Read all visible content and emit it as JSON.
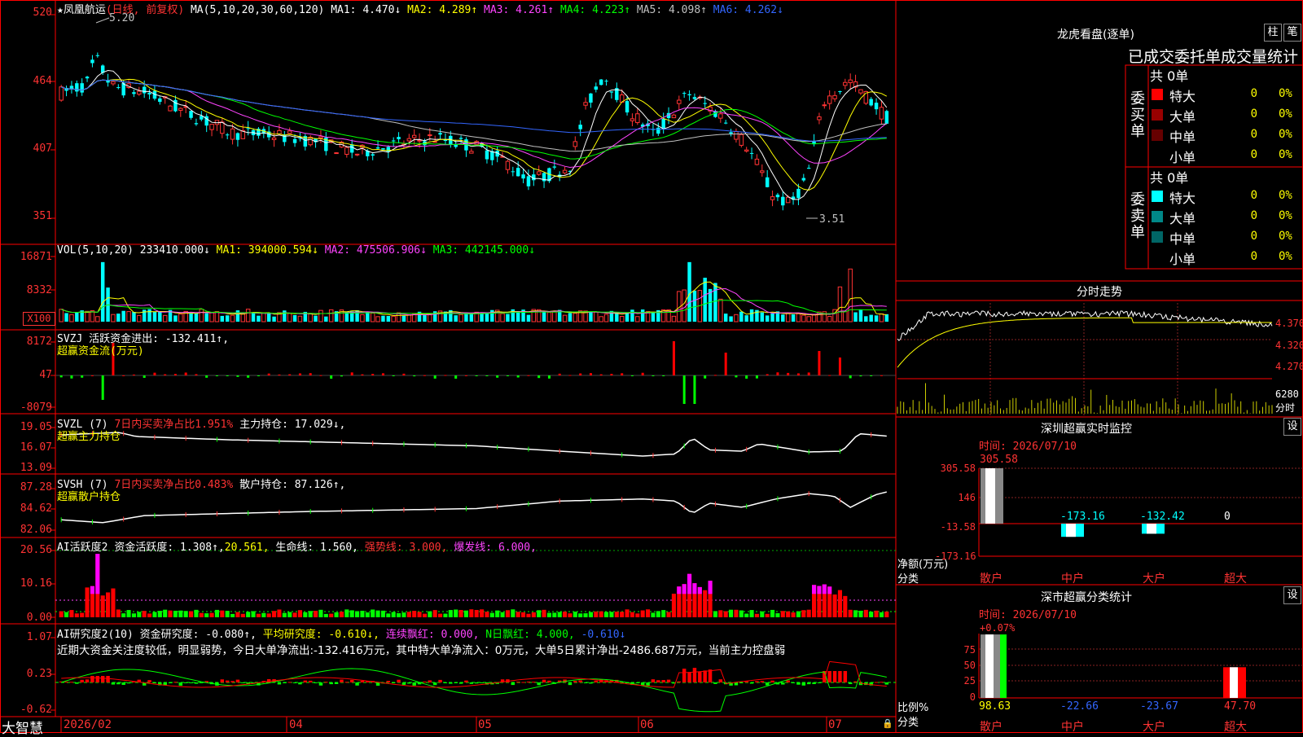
{
  "main_header": {
    "star": "★",
    "name": "凤凰航运",
    "period": "(日线, 前复权)",
    "ma_params": "MA(5,10,20,30,60,120)",
    "ma": [
      {
        "label": "MA1: 4.470↓",
        "color": "#ffffff"
      },
      {
        "label": "MA2: 4.289↑",
        "color": "#ffff00"
      },
      {
        "label": "MA3: 4.261↑",
        "color": "#ff44ff"
      },
      {
        "label": "MA4: 4.223↑",
        "color": "#00ff00"
      },
      {
        "label": "MA5: 4.098↑",
        "color": "#c0c0c0"
      },
      {
        "label": "MA6: 4.262↓",
        "color": "#3366ff"
      }
    ]
  },
  "main_axis": [
    "520",
    "464",
    "407",
    "351"
  ],
  "high_label": "5.20",
  "low_label": "3.51",
  "vol_header": {
    "name": "VOL(5,10,20)",
    "val": "233410.000↓",
    "ma1": "MA1: 394000.594↓",
    "ma2": "MA2: 475506.906↓",
    "ma3": "MA3: 442145.000↓"
  },
  "vol_axis": [
    "16871",
    "8332",
    "X100"
  ],
  "svzj_header": {
    "name": "SVZJ",
    "desc": "活跃资金进出: -132.411↑,",
    "sub": "超赢资金流(万元)"
  },
  "svzj_axis": [
    "8172",
    "47",
    "-8079"
  ],
  "svzl_header": {
    "name": "SVZL (7)",
    "desc": "7日内买卖净占比1.951%",
    "pos": "主力持仓: 17.029↓,",
    "sub": "超赢主力持仓"
  },
  "svzl_axis": [
    "19.05",
    "16.07",
    "13.09"
  ],
  "svsh_header": {
    "name": "SVSH (7)",
    "desc": "7日内买卖净占比0.483%",
    "pos": "散户持仓: 87.126↑,",
    "sub": "超赢散户持仓"
  },
  "svsh_axis": [
    "87.28",
    "84.62",
    "82.06"
  ],
  "ai1_header": {
    "name": "AI活跃度2",
    "a": "资金活跃度: 1.308↑,",
    "b": "20.561,",
    "c": "生命线: 1.560,",
    "d": "强势线: 3.000,",
    "e": "爆发线: 6.000,"
  },
  "ai1_axis": [
    "20.56",
    "10.16",
    "0.00"
  ],
  "ai2_header": {
    "name": "AI研究度2(10)",
    "a": "资金研究度: -0.080↑,",
    "b": "平均研究度: -0.610↓,",
    "c": "连续飘红: 0.000,",
    "d": "N日飘红: 4.000,",
    "e": "-0.610↓"
  },
  "ai2_note": "近期大资金关注度较低，明显弱势，今日大单净流出:-132.416万元，其中特大单净流入：0万元，大单5日累计净出-2486.687万元，当前主力控盘弱",
  "ai2_axis": [
    "1.07",
    "0.23",
    "-0.62"
  ],
  "bottom": {
    "brand": "大智慧",
    "dates": [
      "2026/02",
      "04",
      "05",
      "06",
      "07"
    ]
  },
  "lhb": {
    "title": "龙虎看盘(逐单)",
    "btn1": "柱",
    "btn2": "笔",
    "subtitle": "已成交委托单成交量统计",
    "buy_label": "委买单",
    "sell_label": "委卖单",
    "buy_total": "共 0单",
    "sell_total": "共 0单",
    "rows": [
      {
        "name": "特大",
        "vol": "0",
        "pct": "0%"
      },
      {
        "name": "大单",
        "vol": "0",
        "pct": "0%"
      },
      {
        "name": "中单",
        "vol": "0",
        "pct": "0%"
      },
      {
        "name": "小单",
        "vol": "0",
        "pct": "0%"
      }
    ],
    "buy_colors": [
      "#ff0000",
      "#990000",
      "#660000",
      ""
    ],
    "sell_colors": [
      "#00ffff",
      "#008888",
      "#006666",
      ""
    ]
  },
  "intraday": {
    "title": "分时走势",
    "axis": [
      "4.370",
      "4.320",
      "4.270"
    ],
    "vol_axis": [
      "6280",
      "分时"
    ]
  },
  "sz_monitor": {
    "title": "深圳超赢实时监控",
    "btn": "设",
    "time": "时间: 2026/07/10",
    "axis": [
      "305.58",
      "146",
      "-13.58",
      "-173.16"
    ],
    "ylabel1": "净额(万元)",
    "ylabel2": "分类",
    "cats": [
      "散户",
      "中户",
      "大户",
      "超大"
    ],
    "values": [
      "305.58",
      "-173.16",
      "-132.42",
      "0"
    ]
  },
  "sz_class": {
    "title": "深市超赢分类统计",
    "btn": "设",
    "time": "时间: 2026/07/10",
    "top_pct": "+0.07%",
    "axis": [
      "75",
      "50",
      "25",
      "0"
    ],
    "ylabel1": "比例%",
    "ylabel2": "分类",
    "cats": [
      "散户",
      "中户",
      "大户",
      "超大"
    ],
    "values": [
      "98.63",
      "-22.66",
      "-23.67",
      "47.70"
    ]
  },
  "chart_data": [
    {
      "type": "candlestick",
      "title": "凤凰航运 (日线, 前复权)",
      "x_labels": [
        "2026/02",
        "04",
        "05",
        "06",
        "07"
      ],
      "ylim": [
        3.51,
        5.2
      ],
      "axis_ticks": [
        5.2,
        4.64,
        4.07,
        3.51
      ],
      "series": [
        {
          "name": "MA1",
          "last": 4.47
        },
        {
          "name": "MA2",
          "last": 4.289
        },
        {
          "name": "MA3",
          "last": 4.261
        },
        {
          "name": "MA4",
          "last": 4.223
        },
        {
          "name": "MA5",
          "last": 4.098
        },
        {
          "name": "MA6",
          "last": 4.262
        }
      ]
    },
    {
      "type": "bar",
      "title": "VOL(5,10,20)",
      "ylim": [
        0,
        16871
      ],
      "last": 233410.0,
      "series": [
        {
          "name": "MA1",
          "last": 394000.594
        },
        {
          "name": "MA2",
          "last": 475506.906
        },
        {
          "name": "MA3",
          "last": 442145.0
        }
      ]
    },
    {
      "type": "bar",
      "title": "SVZJ 超赢资金流(万元)",
      "ylim": [
        -8079,
        8172
      ],
      "last": -132.411
    },
    {
      "type": "line",
      "title": "SVZL (7) 超赢主力持仓",
      "ylim": [
        13.09,
        19.05
      ],
      "last": 17.029
    },
    {
      "type": "line",
      "title": "SVSH (7) 超赢散户持仓",
      "ylim": [
        82.06,
        87.28
      ],
      "last": 87.126
    },
    {
      "type": "bar",
      "title": "AI活跃度2",
      "ylim": [
        0,
        20.56
      ],
      "last": 1.308
    },
    {
      "type": "bar",
      "title": "AI研究度2(10)",
      "ylim": [
        -0.62,
        1.07
      ],
      "last": -0.08
    },
    {
      "type": "bar",
      "title": "深圳超赢实时监控",
      "categories": [
        "散户",
        "中户",
        "大户",
        "超大"
      ],
      "values": [
        305.58,
        -173.16,
        -132.42,
        0
      ],
      "ylim": [
        -173.16,
        305.58
      ]
    },
    {
      "type": "bar",
      "title": "深市超赢分类统计",
      "categories": [
        "散户",
        "中户",
        "大户",
        "超大"
      ],
      "values": [
        98.63,
        -22.66,
        -23.67,
        47.7
      ],
      "ylim": [
        0,
        98.63
      ]
    }
  ]
}
